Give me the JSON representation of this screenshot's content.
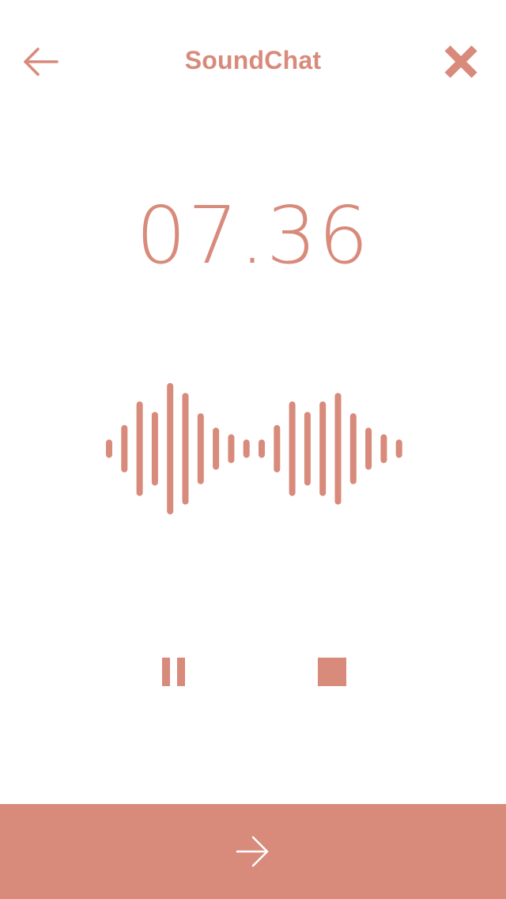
{
  "app": {
    "title": "SoundChat"
  },
  "header": {
    "back_icon": "back-arrow-icon",
    "close_icon": "close-x-icon"
  },
  "recording": {
    "elapsed": "07.36"
  },
  "waveform": {
    "bar_levels": [
      0.14,
      0.36,
      0.72,
      0.56,
      1.0,
      0.85,
      0.54,
      0.32,
      0.22,
      0.14,
      0.14,
      0.36,
      0.72,
      0.56,
      0.72,
      0.85,
      0.54,
      0.32,
      0.22,
      0.14
    ]
  },
  "controls": {
    "pause_icon": "pause-icon",
    "stop_icon": "stop-icon",
    "next_icon": "forward-arrow-icon"
  },
  "colors": {
    "accent": "#D88A7B",
    "background": "#FFFFFF",
    "footer_icon": "#FFFFFF"
  }
}
